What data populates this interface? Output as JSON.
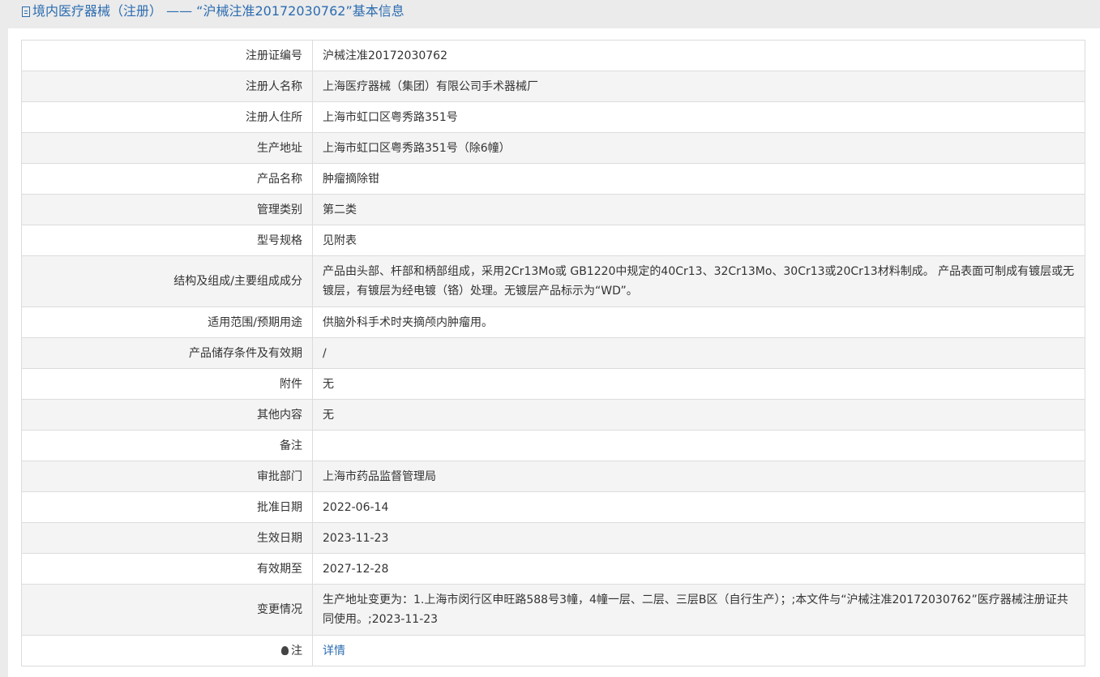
{
  "header": {
    "title": "境内医疗器械（注册） —— “沪械注准20172030762”基本信息"
  },
  "rows": [
    {
      "label": "注册证编号",
      "value": "沪械注准20172030762"
    },
    {
      "label": "注册人名称",
      "value": "上海医疗器械（集团）有限公司手术器械厂"
    },
    {
      "label": "注册人住所",
      "value": "上海市虹口区粤秀路351号"
    },
    {
      "label": "生产地址",
      "value": "上海市虹口区粤秀路351号（除6幢）"
    },
    {
      "label": "产品名称",
      "value": "肿瘤摘除钳"
    },
    {
      "label": "管理类别",
      "value": "第二类"
    },
    {
      "label": "型号规格",
      "value": "见附表"
    },
    {
      "label": "结构及组成/主要组成成分",
      "value": "产品由头部、杆部和柄部组成，采用2Cr13Mo或 GB1220中规定的40Cr13、32Cr13Mo、30Cr13或20Cr13材料制成。 产品表面可制成有镀层或无镀层，有镀层为经电镀（铬）处理。无镀层产品标示为“WD”。"
    },
    {
      "label": "适用范围/预期用途",
      "value": "供脑外科手术时夹摘颅内肿瘤用。"
    },
    {
      "label": "产品储存条件及有效期",
      "value": "/"
    },
    {
      "label": "附件",
      "value": "无"
    },
    {
      "label": "其他内容",
      "value": "无"
    },
    {
      "label": "备注",
      "value": ""
    },
    {
      "label": "审批部门",
      "value": "上海市药品监督管理局"
    },
    {
      "label": "批准日期",
      "value": "2022-06-14"
    },
    {
      "label": "生效日期",
      "value": "2023-11-23"
    },
    {
      "label": "有效期至",
      "value": "2027-12-28"
    },
    {
      "label": "变更情况",
      "value": "生产地址变更为：1.上海市闵行区申旺路588号3幢，4幢一层、二层、三层B区（自行生产）；;本文件与“沪械注准20172030762”医疗器械注册证共同使用。;2023-11-23"
    }
  ],
  "note": {
    "label": "注",
    "icon": "lightbulb-icon",
    "link_label": "详情"
  },
  "colors": {
    "accent": "#2b6cb0",
    "alt_row": "#f4f4f4",
    "border": "#dcdcdc"
  }
}
